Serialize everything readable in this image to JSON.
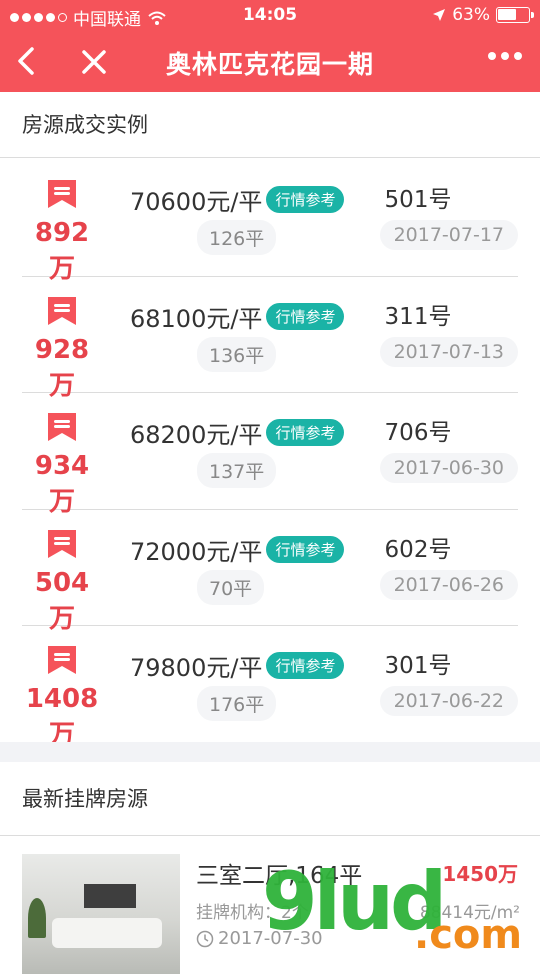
{
  "status_bar": {
    "carrier": "中国联通",
    "time": "14:05",
    "battery": "63%",
    "battery_level": 0.63
  },
  "nav": {
    "title": "奥林匹克花园一期"
  },
  "deals_section": {
    "title": "房源成交实例",
    "badge_label": "行情参考",
    "rows": [
      {
        "total": "892万",
        "unit_price": "70600元/平",
        "area": "126平",
        "unit": "501号",
        "date": "2017-07-17"
      },
      {
        "total": "928万",
        "unit_price": "68100元/平",
        "area": "136平",
        "unit": "311号",
        "date": "2017-07-13"
      },
      {
        "total": "934万",
        "unit_price": "68200元/平",
        "area": "137平",
        "unit": "706号",
        "date": "2017-06-30"
      },
      {
        "total": "504万",
        "unit_price": "72000元/平",
        "area": "70平",
        "unit": "602号",
        "date": "2017-06-26"
      },
      {
        "total": "1408万",
        "unit_price": "79800元/平",
        "area": "176平",
        "unit": "301号",
        "date": "2017-06-22"
      }
    ]
  },
  "listings_section": {
    "title": "最新挂牌房源",
    "items": [
      {
        "title": "三室二厅,164平",
        "price": "1450万",
        "agency": "挂牌机构：2个",
        "unit_price": "88414元/m²",
        "date": "2017-07-30"
      }
    ]
  },
  "watermark": {
    "main": "9lud",
    "suffix": ".com"
  },
  "colors": {
    "header": "#f5535a",
    "price_red": "#e6434b",
    "badge_teal": "#1ab3a6"
  }
}
